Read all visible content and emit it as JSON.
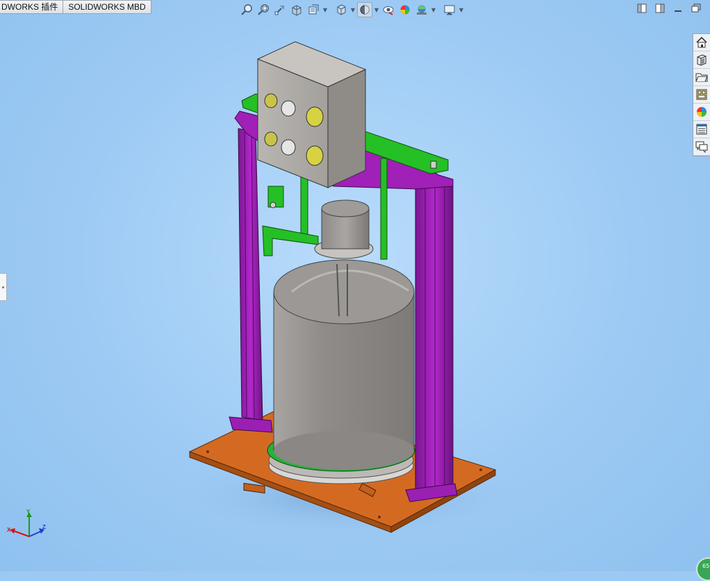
{
  "tabs": [
    {
      "label": "DWORKS 插件"
    },
    {
      "label": "SOLIDWORKS MBD"
    }
  ],
  "heads_up_toolbar": {
    "icons": [
      "zoom-to-fit-icon",
      "zoom-to-area-icon",
      "previous-view-icon",
      "section-view-icon",
      "dynamic-annotation-icon",
      "view-orientation-icon",
      "display-style-icon",
      "hide-show-items-icon",
      "edit-appearance-icon",
      "apply-scene-icon",
      "view-settings-icon"
    ]
  },
  "window_controls": [
    "tile-left-icon",
    "tile-right-icon",
    "minimize-icon",
    "restore-icon"
  ],
  "task_pane": [
    "solidworks-resources-icon",
    "design-library-icon",
    "file-explorer-icon",
    "view-palette-icon",
    "appearances-icon",
    "custom-properties-icon",
    "forum-icon"
  ],
  "triad": {
    "x_label": "X",
    "y_label": "Y",
    "z_label": "Z"
  },
  "corner_badge": "65",
  "colors": {
    "viewport_background": "#9cc9f3",
    "base_plate": "#d2691e",
    "frame_posts": "#9b1fb3",
    "brackets": "#1fc21f",
    "control_box": "#a9a6a2",
    "tank": "#8d8a87"
  }
}
